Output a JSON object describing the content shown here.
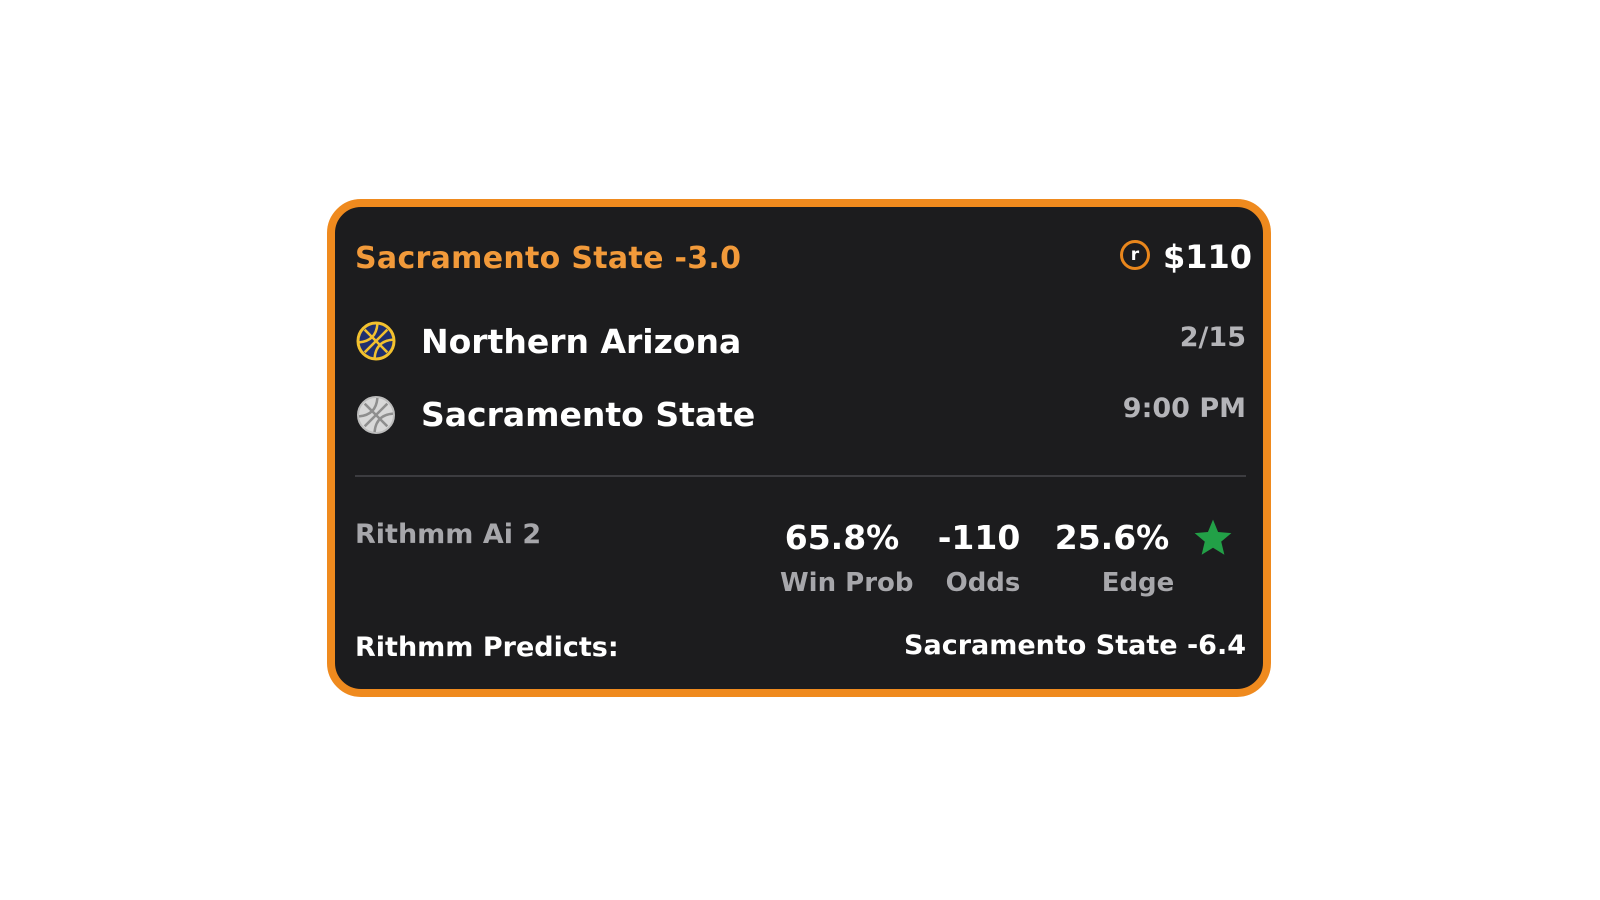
{
  "bet": {
    "title": "Sacramento State -3.0",
    "coin_icon": "rithmm-coin-icon",
    "coin_letter": "r",
    "stake": "$110"
  },
  "teams": [
    {
      "name": "Northern Arizona",
      "icon": "basketball-icon",
      "color": "#f2c12e"
    },
    {
      "name": "Sacramento State",
      "icon": "basketball-icon",
      "color": "#d8d8d8"
    }
  ],
  "game": {
    "date": "2/15",
    "time": "9:00 PM"
  },
  "model": {
    "name": "Rithmm Ai 2"
  },
  "stats": {
    "win_prob_value": "65.8%",
    "win_prob_label": "Win Prob",
    "odds_value": "-110",
    "odds_label": "Odds",
    "edge_value": "25.6%",
    "edge_label": "Edge",
    "edge_icon": "star-icon"
  },
  "prediction": {
    "label": "Rithmm Predicts:",
    "value": "Sacramento State -6.4"
  },
  "colors": {
    "accent": "#ef8a1e",
    "title": "#f29a3a",
    "background": "#1c1c1e",
    "star": "#22a047"
  }
}
